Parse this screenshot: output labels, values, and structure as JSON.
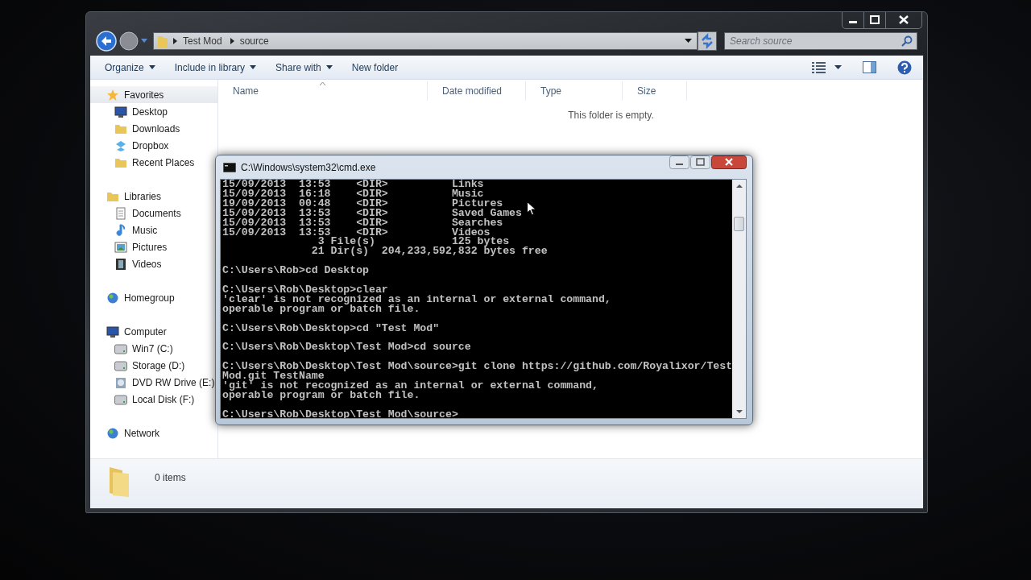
{
  "explorer": {
    "address": {
      "path": [
        "Test Mod",
        "source"
      ]
    },
    "search": {
      "placeholder": "Search source"
    },
    "toolbar": [
      {
        "label": "Organize",
        "dropdown": true
      },
      {
        "label": "Include in library",
        "dropdown": true
      },
      {
        "label": "Share with",
        "dropdown": true
      },
      {
        "label": "New folder",
        "dropdown": false
      }
    ],
    "columns": [
      {
        "label": "Name",
        "sorted": true
      },
      {
        "label": "Date modified",
        "sorted": false
      },
      {
        "label": "Type",
        "sorted": false
      },
      {
        "label": "Size",
        "sorted": false
      }
    ],
    "empty_message": "This folder is empty.",
    "sidebar": [
      {
        "label": "Favorites",
        "kind": "star",
        "selected": true,
        "children": [
          {
            "label": "Desktop",
            "kind": "monitor",
            "selected": false
          },
          {
            "label": "Downloads",
            "kind": "folder",
            "selected": false
          },
          {
            "label": "Dropbox",
            "kind": "box",
            "selected": false
          },
          {
            "label": "Recent Places",
            "kind": "folder",
            "selected": false
          }
        ]
      },
      {
        "label": "Libraries",
        "kind": "folder",
        "selected": false,
        "children": [
          {
            "label": "Documents",
            "kind": "document",
            "selected": false
          },
          {
            "label": "Music",
            "kind": "note",
            "selected": false
          },
          {
            "label": "Pictures",
            "kind": "picture",
            "selected": false
          },
          {
            "label": "Videos",
            "kind": "film",
            "selected": false
          }
        ]
      },
      {
        "label": "Homegroup",
        "kind": "globe",
        "selected": false
      },
      {
        "label": "Computer",
        "kind": "monitor",
        "selected": false,
        "children": [
          {
            "label": "Win7 (C:)",
            "kind": "drive",
            "selected": false
          },
          {
            "label": "Storage (D:)",
            "kind": "drive",
            "selected": false
          },
          {
            "label": "DVD RW Drive (E:)",
            "kind": "disc",
            "selected": false
          },
          {
            "label": "Local Disk (F:)",
            "kind": "drive",
            "selected": false
          }
        ]
      },
      {
        "label": "Network",
        "kind": "globe",
        "selected": false
      }
    ],
    "status": "0 items"
  },
  "console": {
    "title": "C:\\Windows\\system32\\cmd.exe",
    "blocks": [
      [
        "15/09/2013  13:53    <DIR>          Links",
        "15/09/2013  16:18    <DIR>          Music",
        "19/09/2013  00:48    <DIR>          Pictures",
        "15/09/2013  13:53    <DIR>          Saved Games",
        "15/09/2013  13:53    <DIR>          Searches",
        "15/09/2013  13:53    <DIR>          Videos",
        "               3 File(s)            125 bytes",
        "              21 Dir(s)  204,233,592,832 bytes free"
      ],
      [
        "C:\\Users\\Rob>cd Desktop"
      ],
      [
        "C:\\Users\\Rob\\Desktop>clear",
        "'clear' is not recognized as an internal or external command,",
        "operable program or batch file."
      ],
      [
        "C:\\Users\\Rob\\Desktop>cd \"Test Mod\""
      ],
      [
        "C:\\Users\\Rob\\Desktop\\Test Mod>cd source"
      ],
      [
        "C:\\Users\\Rob\\Desktop\\Test Mod\\source>git clone https://github.com/Royalixor/Test",
        "Mod.git TestName",
        "'git' is not recognized as an internal or external command,",
        "operable program or batch file."
      ],
      [
        "C:\\Users\\Rob\\Desktop\\Test Mod\\source>"
      ]
    ]
  }
}
